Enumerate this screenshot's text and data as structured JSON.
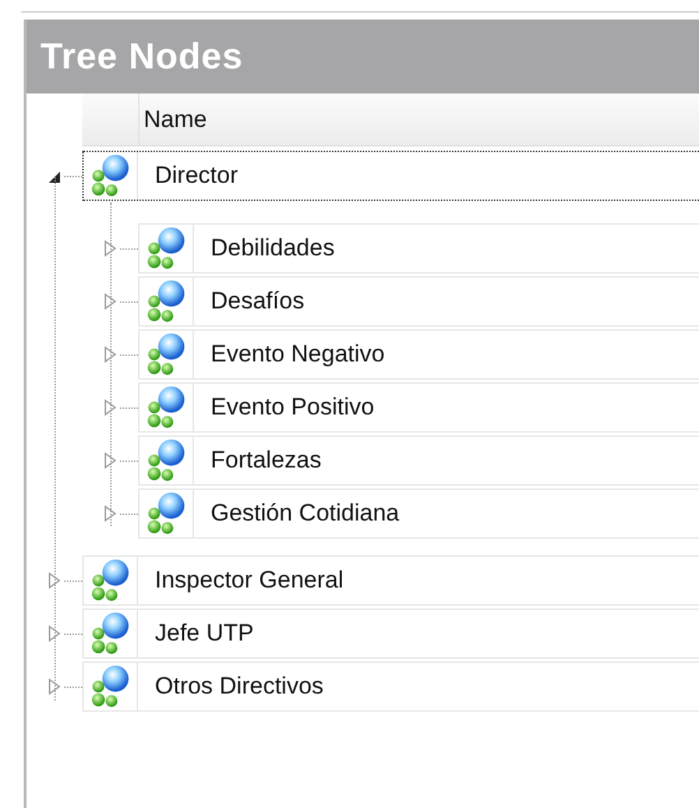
{
  "panel": {
    "title": "Tree Nodes"
  },
  "tree": {
    "columns": [
      "Name"
    ],
    "nodes": [
      {
        "label": "Director",
        "expanded": true,
        "selected": true,
        "children": [
          {
            "label": "Debilidades",
            "expanded": false,
            "selected": false
          },
          {
            "label": "Desafíos",
            "expanded": false,
            "selected": false
          },
          {
            "label": "Evento Negativo",
            "expanded": false,
            "selected": false
          },
          {
            "label": "Evento Positivo",
            "expanded": false,
            "selected": false
          },
          {
            "label": "Fortalezas",
            "expanded": false,
            "selected": false
          },
          {
            "label": "Gestión Cotidiana",
            "expanded": false,
            "selected": false
          }
        ]
      },
      {
        "label": "Inspector General",
        "expanded": false,
        "selected": false
      },
      {
        "label": "Jefe UTP",
        "expanded": false,
        "selected": false
      },
      {
        "label": "Otros Directivos",
        "expanded": false,
        "selected": false
      }
    ]
  }
}
